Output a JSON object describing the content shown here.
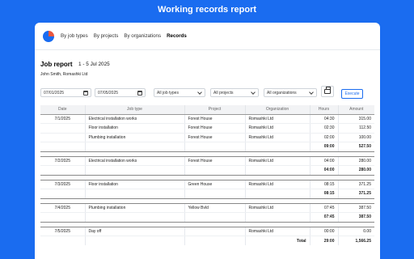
{
  "banner": {
    "title": "Working records report"
  },
  "nav": {
    "links": [
      "By job types",
      "By projects",
      "By organizations",
      "Records"
    ]
  },
  "report": {
    "title": "Job report",
    "range": "1 - 5 Jul 2025",
    "user": "John Smith, Romashki Ltd"
  },
  "filters": {
    "date_from": "07/01/2025",
    "date_to": "07/05/2025",
    "job_types": "All job types",
    "projects": "All projects",
    "organizations": "All organizations",
    "execute_label": "Execute"
  },
  "table": {
    "headers": [
      "Date",
      "Job type",
      "Project",
      "Organization",
      "Hours",
      "Amount"
    ],
    "groups": [
      {
        "date": "7/1/2025",
        "rows": [
          {
            "job": "Electrical installation works",
            "project": "Forest House",
            "org": "Romashki Ltd",
            "hours": "04:30",
            "amount": "315.00"
          },
          {
            "job": "Floor installation",
            "project": "Forest House",
            "org": "Romashki Ltd",
            "hours": "02:30",
            "amount": "112.50"
          },
          {
            "job": "Plumbing installation",
            "project": "Forest House",
            "org": "Romashki Ltd",
            "hours": "02:00",
            "amount": "100.00"
          }
        ],
        "total_hours": "09:00",
        "total_amount": "527.50"
      },
      {
        "date": "7/2/2025",
        "rows": [
          {
            "job": "Electrical installation works",
            "project": "Forest House",
            "org": "Romashki Ltd",
            "hours": "04:00",
            "amount": "280.00"
          }
        ],
        "total_hours": "04:00",
        "total_amount": "280.00"
      },
      {
        "date": "7/3/2025",
        "rows": [
          {
            "job": "Floor installation",
            "project": "Green House",
            "org": "Romashki Ltd",
            "hours": "08:15",
            "amount": "371.25"
          }
        ],
        "total_hours": "08:15",
        "total_amount": "371.25"
      },
      {
        "date": "7/4/2025",
        "rows": [
          {
            "job": "Plumbing installation",
            "project": "Yellow Bvld",
            "org": "Romashki Ltd",
            "hours": "07:45",
            "amount": "387.50"
          }
        ],
        "total_hours": "07:45",
        "total_amount": "387.50"
      },
      {
        "date": "7/5/2025",
        "rows": [
          {
            "job": "Day off",
            "project": "",
            "org": "Romashki Ltd",
            "hours": "00:00",
            "amount": "0.00"
          }
        ]
      }
    ],
    "grand_total_label": "Total",
    "grand_total_hours": "29:00",
    "grand_total_amount": "1,566.25"
  }
}
